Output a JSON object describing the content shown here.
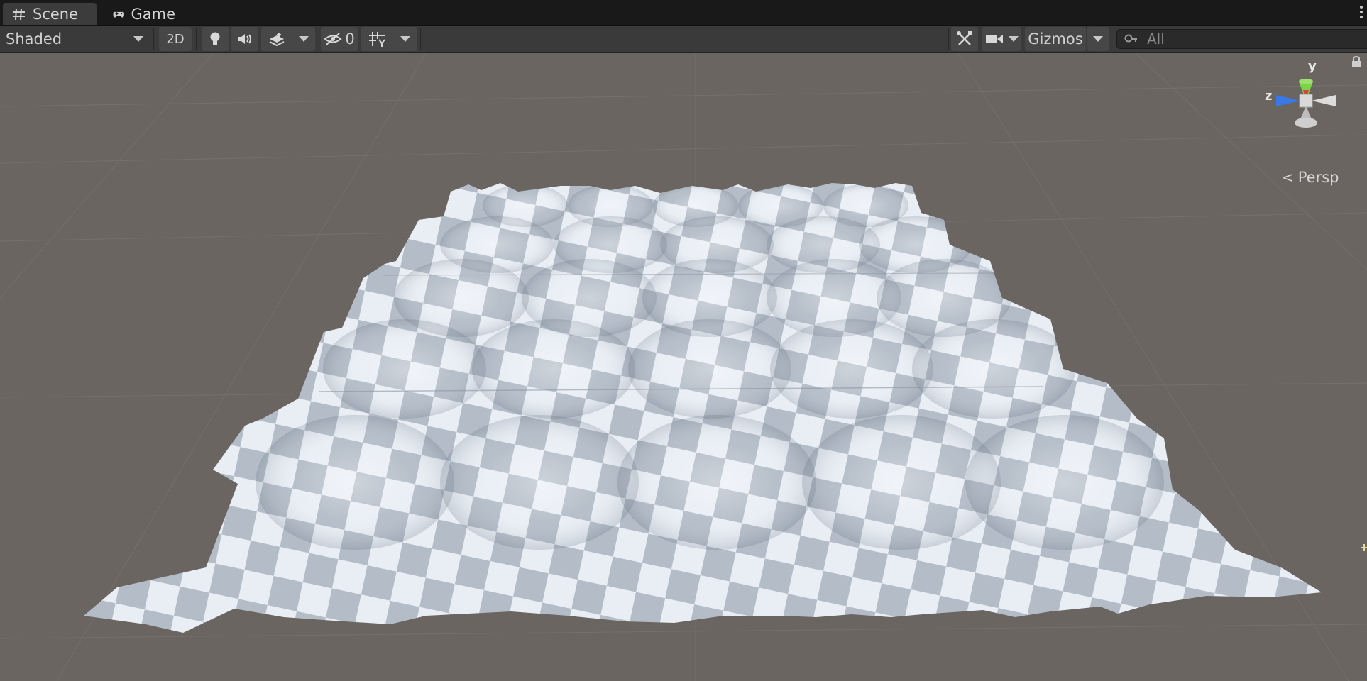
{
  "tabs": [
    {
      "label": "Scene",
      "icon": "scene-grid-icon",
      "active": true
    },
    {
      "label": "Game",
      "icon": "gamepad-icon",
      "active": false
    }
  ],
  "toolbar": {
    "shading_mode": "Shaded",
    "mode_2d_label": "2D",
    "hidden_count": "0",
    "gizmos_label": "Gizmos",
    "search_placeholder": "All"
  },
  "scene": {
    "projection_label": "Persp",
    "axes": {
      "y": "y",
      "z": "z"
    }
  },
  "colors": {
    "background": "#6b6561",
    "axis_y": "#7bd34a",
    "axis_x": "#d9453a",
    "axis_z": "#3a78e6",
    "terrain_light": "#e8eef5",
    "terrain_dark": "#aeb7c2"
  }
}
